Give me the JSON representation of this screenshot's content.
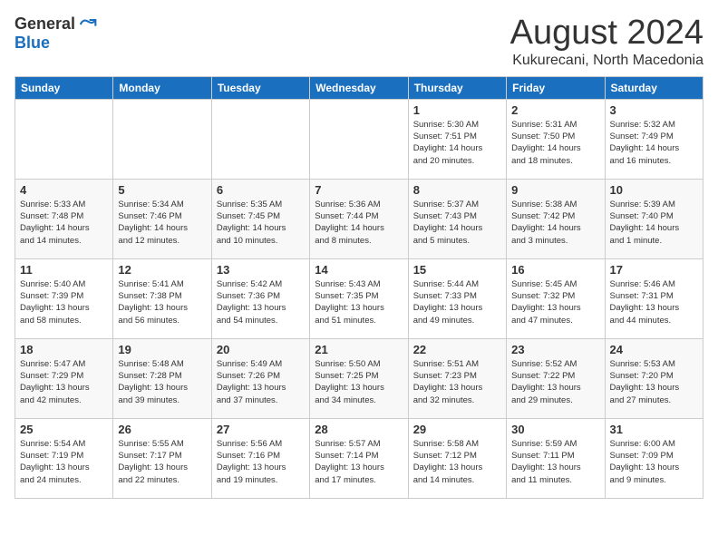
{
  "logo": {
    "general": "General",
    "blue": "Blue"
  },
  "header": {
    "month_year": "August 2024",
    "location": "Kukurecani, North Macedonia"
  },
  "days_of_week": [
    "Sunday",
    "Monday",
    "Tuesday",
    "Wednesday",
    "Thursday",
    "Friday",
    "Saturday"
  ],
  "weeks": [
    [
      {
        "day": "",
        "info": ""
      },
      {
        "day": "",
        "info": ""
      },
      {
        "day": "",
        "info": ""
      },
      {
        "day": "",
        "info": ""
      },
      {
        "day": "1",
        "info": "Sunrise: 5:30 AM\nSunset: 7:51 PM\nDaylight: 14 hours\nand 20 minutes."
      },
      {
        "day": "2",
        "info": "Sunrise: 5:31 AM\nSunset: 7:50 PM\nDaylight: 14 hours\nand 18 minutes."
      },
      {
        "day": "3",
        "info": "Sunrise: 5:32 AM\nSunset: 7:49 PM\nDaylight: 14 hours\nand 16 minutes."
      }
    ],
    [
      {
        "day": "4",
        "info": "Sunrise: 5:33 AM\nSunset: 7:48 PM\nDaylight: 14 hours\nand 14 minutes."
      },
      {
        "day": "5",
        "info": "Sunrise: 5:34 AM\nSunset: 7:46 PM\nDaylight: 14 hours\nand 12 minutes."
      },
      {
        "day": "6",
        "info": "Sunrise: 5:35 AM\nSunset: 7:45 PM\nDaylight: 14 hours\nand 10 minutes."
      },
      {
        "day": "7",
        "info": "Sunrise: 5:36 AM\nSunset: 7:44 PM\nDaylight: 14 hours\nand 8 minutes."
      },
      {
        "day": "8",
        "info": "Sunrise: 5:37 AM\nSunset: 7:43 PM\nDaylight: 14 hours\nand 5 minutes."
      },
      {
        "day": "9",
        "info": "Sunrise: 5:38 AM\nSunset: 7:42 PM\nDaylight: 14 hours\nand 3 minutes."
      },
      {
        "day": "10",
        "info": "Sunrise: 5:39 AM\nSunset: 7:40 PM\nDaylight: 14 hours\nand 1 minute."
      }
    ],
    [
      {
        "day": "11",
        "info": "Sunrise: 5:40 AM\nSunset: 7:39 PM\nDaylight: 13 hours\nand 58 minutes."
      },
      {
        "day": "12",
        "info": "Sunrise: 5:41 AM\nSunset: 7:38 PM\nDaylight: 13 hours\nand 56 minutes."
      },
      {
        "day": "13",
        "info": "Sunrise: 5:42 AM\nSunset: 7:36 PM\nDaylight: 13 hours\nand 54 minutes."
      },
      {
        "day": "14",
        "info": "Sunrise: 5:43 AM\nSunset: 7:35 PM\nDaylight: 13 hours\nand 51 minutes."
      },
      {
        "day": "15",
        "info": "Sunrise: 5:44 AM\nSunset: 7:33 PM\nDaylight: 13 hours\nand 49 minutes."
      },
      {
        "day": "16",
        "info": "Sunrise: 5:45 AM\nSunset: 7:32 PM\nDaylight: 13 hours\nand 47 minutes."
      },
      {
        "day": "17",
        "info": "Sunrise: 5:46 AM\nSunset: 7:31 PM\nDaylight: 13 hours\nand 44 minutes."
      }
    ],
    [
      {
        "day": "18",
        "info": "Sunrise: 5:47 AM\nSunset: 7:29 PM\nDaylight: 13 hours\nand 42 minutes."
      },
      {
        "day": "19",
        "info": "Sunrise: 5:48 AM\nSunset: 7:28 PM\nDaylight: 13 hours\nand 39 minutes."
      },
      {
        "day": "20",
        "info": "Sunrise: 5:49 AM\nSunset: 7:26 PM\nDaylight: 13 hours\nand 37 minutes."
      },
      {
        "day": "21",
        "info": "Sunrise: 5:50 AM\nSunset: 7:25 PM\nDaylight: 13 hours\nand 34 minutes."
      },
      {
        "day": "22",
        "info": "Sunrise: 5:51 AM\nSunset: 7:23 PM\nDaylight: 13 hours\nand 32 minutes."
      },
      {
        "day": "23",
        "info": "Sunrise: 5:52 AM\nSunset: 7:22 PM\nDaylight: 13 hours\nand 29 minutes."
      },
      {
        "day": "24",
        "info": "Sunrise: 5:53 AM\nSunset: 7:20 PM\nDaylight: 13 hours\nand 27 minutes."
      }
    ],
    [
      {
        "day": "25",
        "info": "Sunrise: 5:54 AM\nSunset: 7:19 PM\nDaylight: 13 hours\nand 24 minutes."
      },
      {
        "day": "26",
        "info": "Sunrise: 5:55 AM\nSunset: 7:17 PM\nDaylight: 13 hours\nand 22 minutes."
      },
      {
        "day": "27",
        "info": "Sunrise: 5:56 AM\nSunset: 7:16 PM\nDaylight: 13 hours\nand 19 minutes."
      },
      {
        "day": "28",
        "info": "Sunrise: 5:57 AM\nSunset: 7:14 PM\nDaylight: 13 hours\nand 17 minutes."
      },
      {
        "day": "29",
        "info": "Sunrise: 5:58 AM\nSunset: 7:12 PM\nDaylight: 13 hours\nand 14 minutes."
      },
      {
        "day": "30",
        "info": "Sunrise: 5:59 AM\nSunset: 7:11 PM\nDaylight: 13 hours\nand 11 minutes."
      },
      {
        "day": "31",
        "info": "Sunrise: 6:00 AM\nSunset: 7:09 PM\nDaylight: 13 hours\nand 9 minutes."
      }
    ]
  ]
}
